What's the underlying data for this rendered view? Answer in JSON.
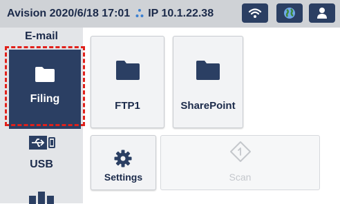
{
  "statusbar": {
    "brand": "Avision",
    "datetime": "2020/6/18 17:01",
    "ip": "IP 10.1.22.38",
    "icons": [
      "wifi-icon",
      "globe-icon",
      "user-icon"
    ]
  },
  "sidebar": {
    "items": [
      {
        "label": "E-mail",
        "icon": "email-icon"
      },
      {
        "label": "Filing",
        "icon": "folder-icon",
        "selected": true
      },
      {
        "label": "USB",
        "icon": "usb-icon"
      },
      {
        "label": "",
        "icon": "network-icon"
      }
    ]
  },
  "tiles": {
    "ftp": {
      "label": "FTP1",
      "icon": "folder-icon"
    },
    "sharepoint": {
      "label": "SharePoint",
      "icon": "folder-icon"
    },
    "settings": {
      "label": "Settings",
      "icon": "gear-icon"
    },
    "scan": {
      "label": "Scan",
      "icon": "scan-icon",
      "enabled": false
    }
  },
  "colors": {
    "accent": "#2b3f63",
    "statusbar": "#cfd2d6",
    "sidebar": "#e3e5e8",
    "highlight": "#e0201a"
  }
}
